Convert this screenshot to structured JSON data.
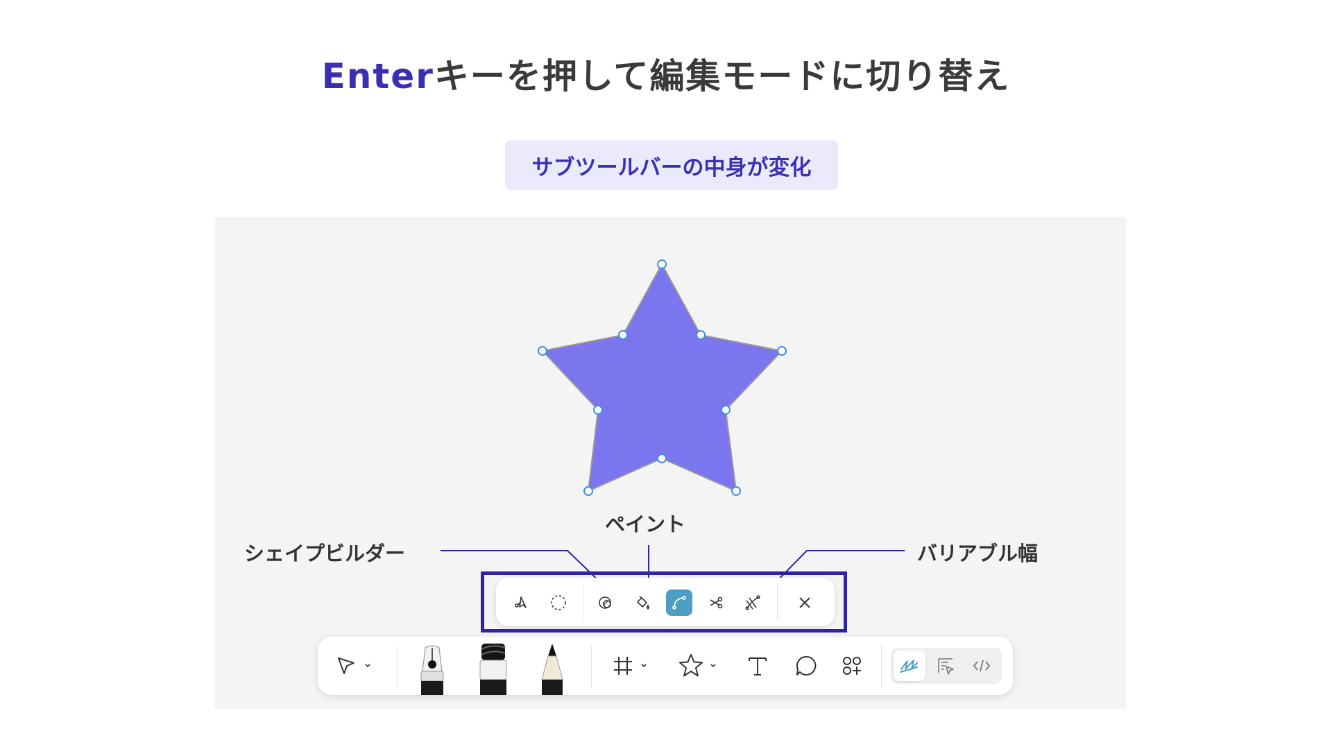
{
  "title": {
    "accent": "Enter",
    "rest": "キーを押して編集モードに切り替え"
  },
  "badge": {
    "label": "サブツールバーの中身が変化"
  },
  "callouts": {
    "shape_builder": "シェイプビルダー",
    "paint": "ペイント",
    "variable_width": "バリアブル幅"
  },
  "colors": {
    "accent": "#3a2fb3",
    "badge_bg": "#ebe9fc",
    "star_fill": "#7b75ee",
    "handle_stroke": "#3d8fe6",
    "active_tool": "#4a9fc3",
    "highlight_border": "#2d23a3",
    "canvas_bg": "#f4f4f4"
  },
  "sub_toolbar": {
    "tools": [
      {
        "name": "bend-tool-icon"
      },
      {
        "name": "lasso-icon"
      },
      {
        "name": "shape-builder-icon"
      },
      {
        "name": "paint-bucket-icon"
      },
      {
        "name": "bend-curve-icon",
        "active": true
      },
      {
        "name": "scissors-icon"
      },
      {
        "name": "variable-width-icon"
      },
      {
        "name": "close-icon"
      }
    ]
  },
  "main_toolbar": {
    "tools": [
      {
        "name": "move-pointer-icon"
      },
      {
        "name": "pen-nib-icon"
      },
      {
        "name": "marker-icon"
      },
      {
        "name": "pencil-icon"
      },
      {
        "name": "frame-hash-icon"
      },
      {
        "name": "star-shape-icon"
      },
      {
        "name": "text-icon"
      },
      {
        "name": "comment-icon"
      },
      {
        "name": "widgets-icon"
      },
      {
        "name": "draw-mode-icon",
        "active": true
      },
      {
        "name": "design-mode-icon"
      },
      {
        "name": "dev-mode-icon"
      }
    ]
  }
}
